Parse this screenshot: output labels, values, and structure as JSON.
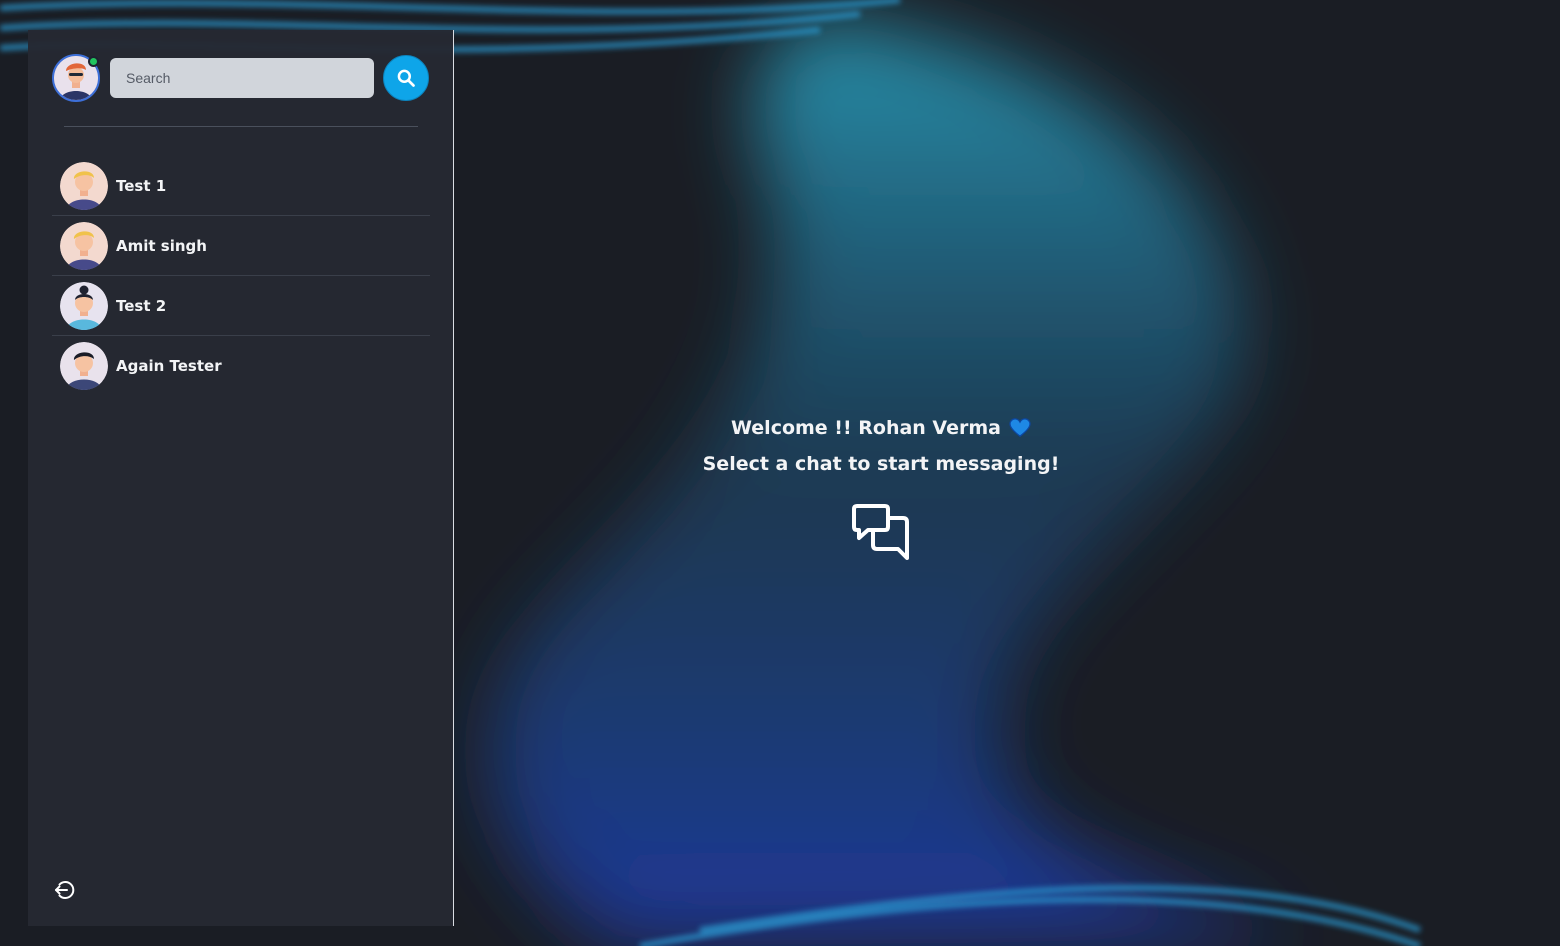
{
  "colors": {
    "background": "#1a1d24",
    "sidebar": "#252932",
    "accent": "#0ea5e9",
    "online": "#22c55e",
    "heart": "#1e88e5"
  },
  "sidebar": {
    "search": {
      "placeholder": "Search",
      "value": ""
    },
    "search_button_icon": "search-icon",
    "user_status": "online",
    "conversations": [
      {
        "name": "Test 1",
        "avatar": "avatar-blonde-man"
      },
      {
        "name": "Amit singh",
        "avatar": "avatar-blonde-man"
      },
      {
        "name": "Test 2",
        "avatar": "avatar-bun-hair"
      },
      {
        "name": "Again Tester",
        "avatar": "avatar-dark-hair"
      }
    ],
    "logout_icon": "logout-icon"
  },
  "main": {
    "welcome": "Welcome !! Rohan Verma",
    "heart_icon": "blue-heart-icon",
    "prompt": "Select a chat to start messaging!",
    "chat_icon": "chat-bubbles-icon"
  }
}
